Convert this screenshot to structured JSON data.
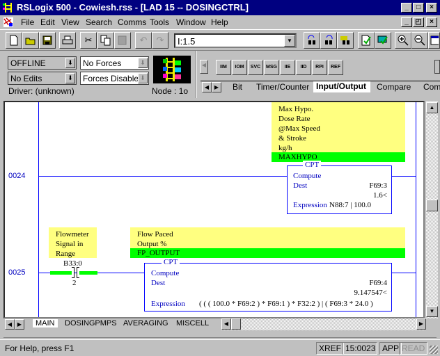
{
  "window": {
    "title": "RSLogix 500 - Cowiesh.rss - [LAD 15 -- DOSINGCTRL]",
    "minimize": "_",
    "maximize": "□",
    "close": "×",
    "restore": "◰"
  },
  "menu": [
    "File",
    "Edit",
    "View",
    "Search",
    "Comms",
    "Tools",
    "Window",
    "Help"
  ],
  "toolbar": {
    "address_value": "I:1.5",
    "icons": [
      "new-file-icon",
      "open-folder-icon",
      "save-icon",
      "print-icon",
      "cut-icon",
      "copy-icon",
      "paste-icon",
      "undo-icon",
      "redo-icon",
      "find-prev-icon",
      "find-next-icon",
      "find-all-icon",
      "verify-file-icon",
      "verify-project-icon",
      "zoom-in-icon",
      "zoom-out-icon",
      "calendar-icon"
    ]
  },
  "status_panel": {
    "mode": "OFFLINE",
    "edits": "No Edits",
    "forces": "No Forces",
    "forces_enabled": "Forces Disabled",
    "driver": "Driver: (unknown)",
    "node": "Node : 1o"
  },
  "instruction_palette": {
    "buttons": [
      "IIM",
      "IOM",
      "SVC",
      "MSG",
      "IIE",
      "IID",
      "RPI",
      "REF"
    ],
    "tabs": [
      "Bit",
      "Timer/Counter",
      "Input/Output",
      "Compare",
      "Com"
    ],
    "active_tab": "Input/Output"
  },
  "rungs": [
    {
      "number": "0024",
      "comment": [
        "Max Hypo.",
        "Dose Rate",
        "@Max Speed",
        "& Stroke",
        "kg/h"
      ],
      "symbol": "MAXHYPO",
      "instruction": {
        "name": "CPT",
        "title": "Compute",
        "dest_label": "Dest",
        "dest": "F69:3",
        "dest_value": "1.6<",
        "expr_label": "Expression",
        "expression": "N88:7 | 100.0"
      }
    },
    {
      "number": "0025",
      "contact": {
        "comment": [
          "Flowmeter",
          "Signal in",
          "Range"
        ],
        "address": "B33:0",
        "bit": "2"
      },
      "comment": [
        "Flow Paced",
        "Output %"
      ],
      "symbol": "FP_OUTPUT",
      "instruction": {
        "name": "CPT",
        "title": "Compute",
        "dest_label": "Dest",
        "dest": "F69:4",
        "dest_value": "9.147547<",
        "expr_label": "Expression",
        "expression": "( ( ( 100.0 * F69:2 ) * F69:1 ) * F32:2 ) | ( F69:3 * 24.0 )"
      }
    }
  ],
  "file_tabs": [
    "MAIN",
    "DOSINGPMPS",
    "AVERAGING",
    "MISCELL"
  ],
  "statusbar": {
    "help": "For Help, press F1",
    "xref": "XREF",
    "position": "15:0023",
    "app": "APP",
    "read": "READ"
  }
}
